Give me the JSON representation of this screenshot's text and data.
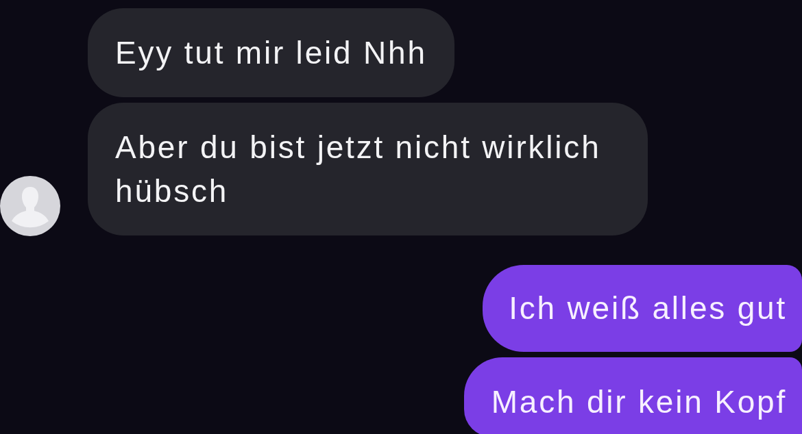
{
  "conversation": [
    {
      "kind": "received",
      "avatar": true,
      "messages": [
        "Eyy tut mir leid Nhh",
        "Aber du bist jetzt nicht wirklich hübsch"
      ]
    },
    {
      "kind": "sent",
      "avatar": false,
      "messages": [
        "Ich weiß alles gut",
        "Mach dir kein Kopf"
      ]
    }
  ]
}
